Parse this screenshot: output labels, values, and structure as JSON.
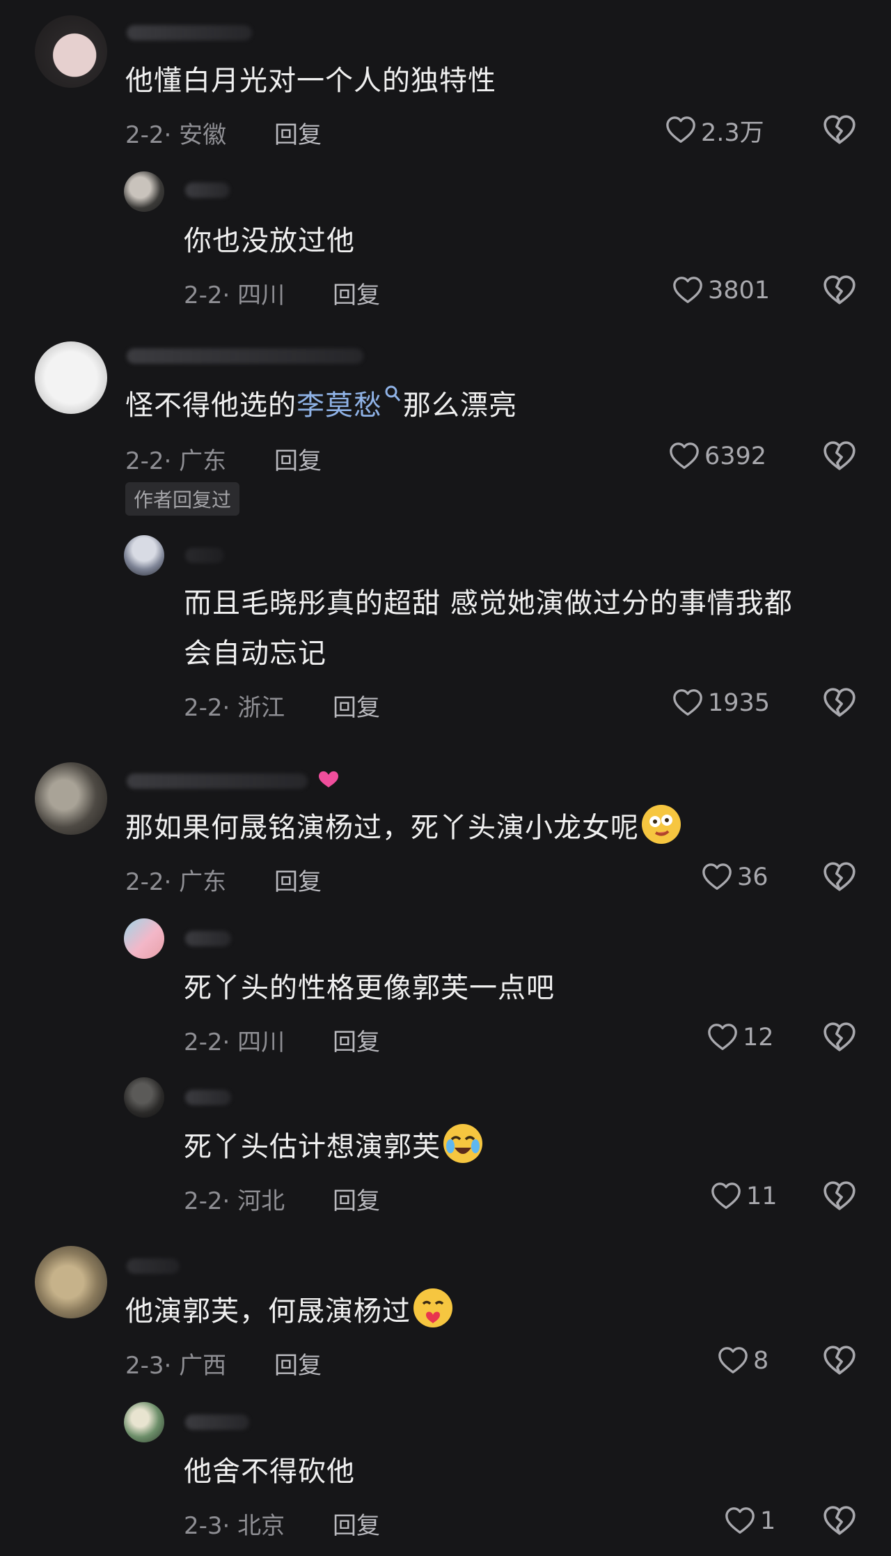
{
  "comments": [
    {
      "text": "他懂白月光对一个人的独特性",
      "meta": "2-2· 安徽",
      "reply": "回复",
      "likes": "2.3万",
      "replies": [
        {
          "text": "你也没放过他",
          "meta": "2-2· 四川",
          "reply": "回复",
          "likes": "3801"
        }
      ]
    },
    {
      "text_before": "怪不得他选的",
      "link_text": "李莫愁",
      "text_after": "那么漂亮",
      "meta": "2-2· 广东",
      "reply": "回复",
      "likes": "6392",
      "badge": "作者回复过",
      "replies": [
        {
          "line1": "而且毛晓彤真的超甜 感觉她演做过分的事情我都",
          "line2": "会自动忘记",
          "meta": "2-2· 浙江",
          "reply": "回复",
          "likes": "1935"
        }
      ]
    },
    {
      "text": "那如果何晟铭演杨过，死丫头演小龙女呢",
      "meta": "2-2· 广东",
      "reply": "回复",
      "likes": "36",
      "replies": [
        {
          "text": "死丫头的性格更像郭芙一点吧",
          "meta": "2-2· 四川",
          "reply": "回复",
          "likes": "12"
        },
        {
          "text": "死丫头估计想演郭芙",
          "meta": "2-2· 河北",
          "reply": "回复",
          "likes": "11"
        }
      ]
    },
    {
      "text": "他演郭芙，何晟演杨过",
      "meta": "2-3· 广西",
      "reply": "回复",
      "likes": "8",
      "replies": [
        {
          "text": "他舍不得砍他",
          "meta": "2-3· 北京",
          "reply": "回复",
          "likes": "1"
        }
      ]
    }
  ],
  "icons": {
    "like": "heart-outline-icon",
    "dislike": "broken-heart-icon",
    "search": "search-icon"
  },
  "colors": {
    "background": "#161618",
    "text": "#f0f0f0",
    "meta": "#8f8f94",
    "link": "#8fb2e6"
  }
}
